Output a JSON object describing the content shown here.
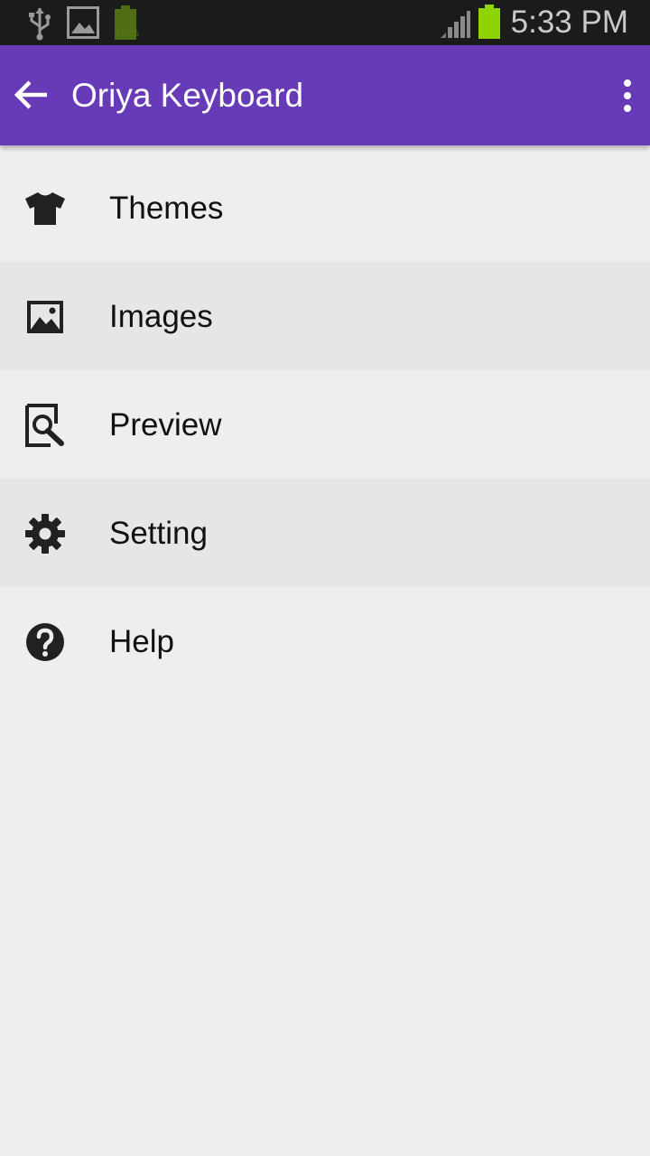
{
  "status_bar": {
    "battery_small_text": "100%",
    "time": "5:33 PM"
  },
  "app_bar": {
    "title": "Oriya Keyboard",
    "color": "#673ab7"
  },
  "menu": {
    "items": [
      {
        "label": "Themes",
        "icon": "tshirt-icon"
      },
      {
        "label": "Images",
        "icon": "image-icon"
      },
      {
        "label": "Preview",
        "icon": "preview-search-icon"
      },
      {
        "label": "Setting",
        "icon": "gear-icon"
      },
      {
        "label": "Help",
        "icon": "help-icon"
      }
    ]
  }
}
